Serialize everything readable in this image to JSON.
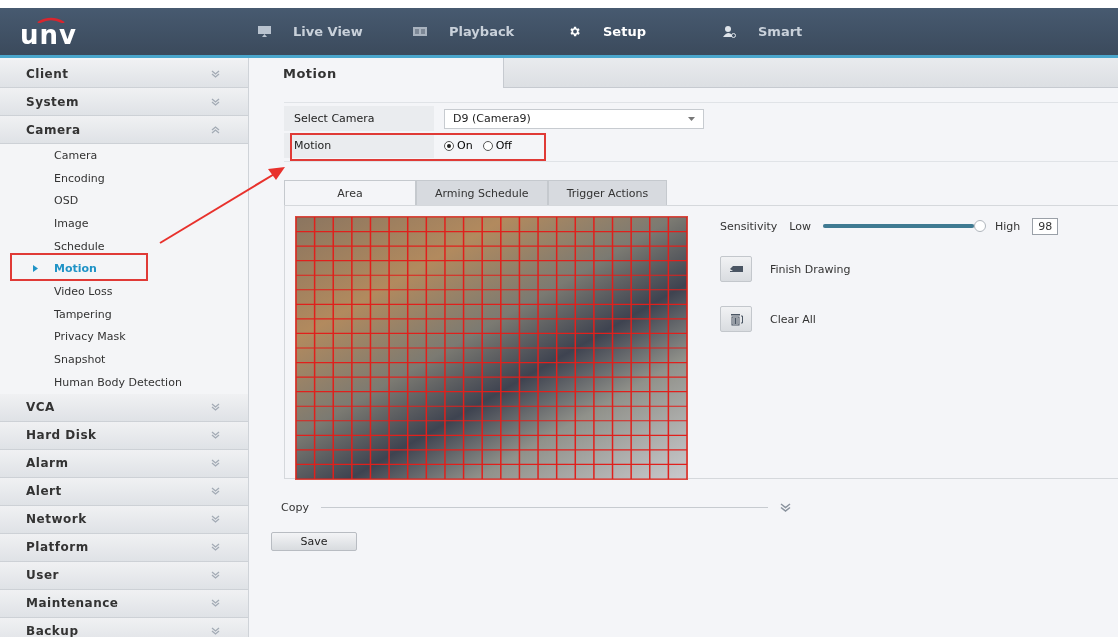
{
  "header": {
    "logo": "unv",
    "nav": [
      {
        "label": "Live View",
        "selected": false
      },
      {
        "label": "Playback",
        "selected": false
      },
      {
        "label": "Setup",
        "selected": true
      },
      {
        "label": "Smart",
        "selected": false
      }
    ]
  },
  "sidebar": {
    "groups": [
      {
        "label": "Client",
        "expanded": false
      },
      {
        "label": "System",
        "expanded": false
      },
      {
        "label": "Camera",
        "expanded": true,
        "items": [
          {
            "label": "Camera",
            "selected": false
          },
          {
            "label": "Encoding",
            "selected": false
          },
          {
            "label": "OSD",
            "selected": false
          },
          {
            "label": "Image",
            "selected": false
          },
          {
            "label": "Schedule",
            "selected": false
          },
          {
            "label": "Motion",
            "selected": true
          },
          {
            "label": "Video Loss",
            "selected": false
          },
          {
            "label": "Tampering",
            "selected": false
          },
          {
            "label": "Privacy Mask",
            "selected": false
          },
          {
            "label": "Snapshot",
            "selected": false
          },
          {
            "label": "Human Body Detection",
            "selected": false
          }
        ]
      },
      {
        "label": "VCA",
        "expanded": false
      },
      {
        "label": "Hard Disk",
        "expanded": false
      },
      {
        "label": "Alarm",
        "expanded": false
      },
      {
        "label": "Alert",
        "expanded": false
      },
      {
        "label": "Network",
        "expanded": false
      },
      {
        "label": "Platform",
        "expanded": false
      },
      {
        "label": "User",
        "expanded": false
      },
      {
        "label": "Maintenance",
        "expanded": false
      },
      {
        "label": "Backup",
        "expanded": false
      }
    ]
  },
  "page": {
    "title": "Motion",
    "select_camera": {
      "label": "Select Camera",
      "value": "D9 (Camera9)"
    },
    "motion": {
      "label": "Motion",
      "options": [
        {
          "label": "On",
          "selected": true
        },
        {
          "label": "Off",
          "selected": false
        }
      ]
    },
    "tabs": [
      {
        "label": "Area",
        "selected": true
      },
      {
        "label": "Arming Schedule",
        "selected": false
      },
      {
        "label": "Trigger Actions",
        "selected": false
      }
    ],
    "sensitivity": {
      "label": "Sensitivity",
      "low": "Low",
      "high": "High",
      "level": 0.98,
      "value": "98"
    },
    "actions": [
      {
        "label": "Finish Drawing"
      },
      {
        "label": "Clear All"
      }
    ],
    "copy": {
      "label": "Copy"
    },
    "save": "Save"
  }
}
